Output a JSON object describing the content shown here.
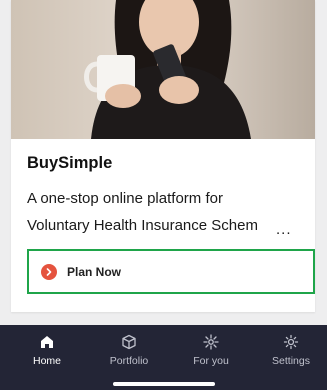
{
  "card": {
    "title": "BuySimple",
    "description_lines": [
      "A one-stop online platform for",
      "Voluntary Health Insurance Schem"
    ],
    "ellipsis": "...",
    "action_label": "Plan Now",
    "action_icon": "chevron-right-icon",
    "action_icon_color": "#e5533e",
    "highlight_color": "#1fa54a"
  },
  "tabbar": {
    "background": "#232536",
    "items": [
      {
        "label": "Home",
        "icon": "home-icon",
        "active": true
      },
      {
        "label": "Portfolio",
        "icon": "cube-icon",
        "active": false
      },
      {
        "label": "For you",
        "icon": "sparkle-icon",
        "active": false
      },
      {
        "label": "Settings",
        "icon": "gear-icon",
        "active": false
      }
    ]
  }
}
